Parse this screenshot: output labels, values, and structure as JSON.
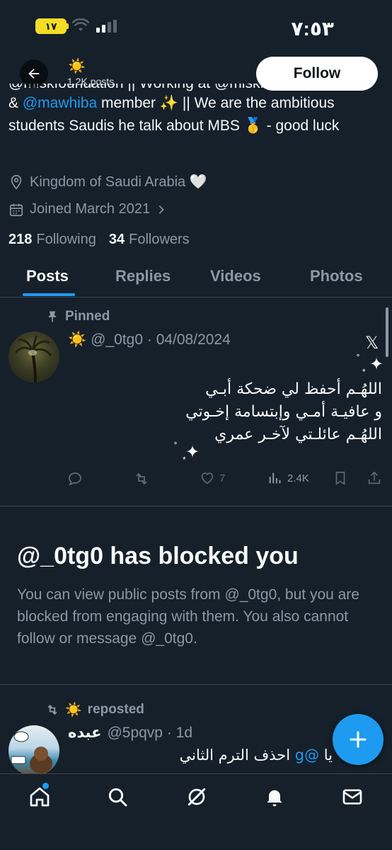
{
  "status_bar": {
    "time": "٧:٥٣",
    "battery": "١٧"
  },
  "header": {
    "emoji": "☀️",
    "posts_count": "1.2K posts",
    "follow_label": "Follow"
  },
  "bio": {
    "line0_cut": "@miskfoundation || Working at @miskfoundation",
    "mention": "@mawhiba",
    "segment1": " member ✨ || We are the ambitious students Saudis he talk about MBS 🥇 - good luck",
    "prefix": "& "
  },
  "meta": {
    "location": "Kingdom of Saudi Arabia 🤍",
    "joined": "Joined March 2021"
  },
  "counts": {
    "following_num": "218",
    "following_label": "Following",
    "followers_num": "34",
    "followers_label": "Followers"
  },
  "tabs": [
    "Posts",
    "Replies",
    "Videos",
    "Photos"
  ],
  "pinned_post": {
    "pinned_label": "Pinned",
    "emoji": "☀️",
    "handle_date": "@_0tg0 · 04/08/2024",
    "x_logo": "𝕏",
    "line1": "اللهُـم أحفظ لي ضحكة أبـي",
    "line2": "و عافيـة أمـي وإبتسامة إخـوتي",
    "line3": "اللهُـم عائلـتي لآخـر عمري",
    "likes": "7",
    "views": "2.4K"
  },
  "blocked": {
    "title": "@_0tg0 has blocked you",
    "text": "You can view public posts from @_0tg0, but you are blocked from engaging with them. You also cannot follow or message @_0tg0."
  },
  "repost": {
    "emoji": "☀️",
    "label": "reposted",
    "name": "عبده",
    "handle_time": "@5pqvp · 1d",
    "text_pre": "يا ",
    "mention": "@g",
    "text_post": " احذف الترم الثاني"
  },
  "colors": {
    "background": "#15202b",
    "accent": "#1d9bf0",
    "muted": "#8b98a5",
    "divider": "#38444d"
  }
}
